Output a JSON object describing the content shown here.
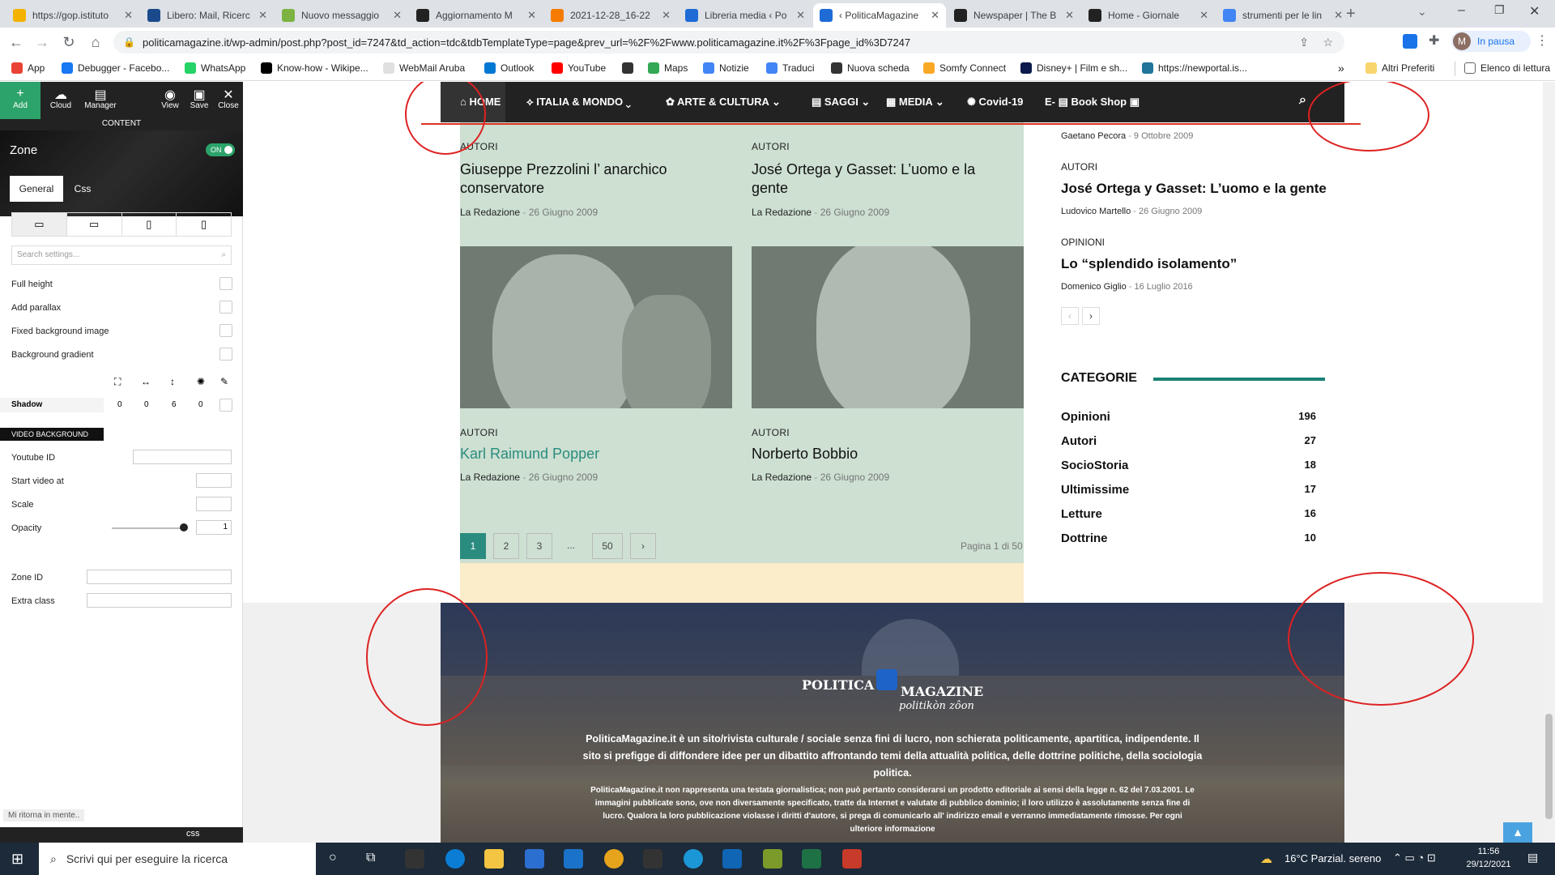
{
  "browser": {
    "tabs": [
      {
        "label": "https://gop.istituto",
        "color": "#f3b300"
      },
      {
        "label": "Libero: Mail, Ricerc",
        "color": "#1a4a8c"
      },
      {
        "label": "Nuovo messaggio",
        "color": "#7cb342"
      },
      {
        "label": "Aggiornamento M",
        "color": "#222222"
      },
      {
        "label": "2021-12-28_16-22",
        "color": "#f57c00"
      },
      {
        "label": "Libreria media ‹ Po",
        "color": "#1e6bd6"
      },
      {
        "label": "‹ PoliticaMagazine",
        "color": "#1e6bd6"
      },
      {
        "label": "Newspaper | The B",
        "color": "#222222"
      },
      {
        "label": "Home - Giornale",
        "color": "#222222"
      },
      {
        "label": "strumenti per le lin",
        "color": "#4285f4"
      }
    ],
    "url": "politicamagazine.it/wp-admin/post.php?post_id=7247&td_action=tdc&tdbTemplateType=page&prev_url=%2F%2Fwww.politicamagazine.it%2F%3Fpage_id%3D7247",
    "profile_label": "In pausa",
    "profile_initial": "M",
    "bookmarks": [
      {
        "label": "App",
        "color": "#ea4335"
      },
      {
        "label": "Debugger - Facebo...",
        "color": "#1877f2"
      },
      {
        "label": "WhatsApp",
        "color": "#25d366"
      },
      {
        "label": "Know-how - Wikipe...",
        "color": "#000000"
      },
      {
        "label": "WebMail Aruba",
        "color": "#e0e0e0"
      },
      {
        "label": "Outlook",
        "color": "#0078d4"
      },
      {
        "label": "YouTube",
        "color": "#ff0000"
      },
      {
        "label": "",
        "color": "#333333"
      },
      {
        "label": "Maps",
        "color": "#34a853"
      },
      {
        "label": "Notizie",
        "color": "#4285f4"
      },
      {
        "label": "Traduci",
        "color": "#4285f4"
      },
      {
        "label": "Nuova scheda",
        "color": "#333333"
      },
      {
        "label": "Somfy Connect",
        "color": "#f9a825"
      },
      {
        "label": "Disney+ | Film e sh...",
        "color": "#0b1a4a"
      },
      {
        "label": "https://newportal.is...",
        "color": "#21759b"
      }
    ],
    "bookmarks_more": "»",
    "bookmarks_other": "Altri Preferiti",
    "reading_list": "Elenco di lettura"
  },
  "editor": {
    "toolbar": {
      "add": "Add",
      "cloud": "Cloud",
      "manager": "Manager",
      "view": "View",
      "save": "Save",
      "close": "Close"
    },
    "content_label": "CONTENT",
    "zone_title": "Zone",
    "zone_toggle": "ON",
    "tabs": {
      "general": "General",
      "css": "Css"
    },
    "search_placeholder": "Search settings...",
    "options": [
      "Full height",
      "Add parallax",
      "Fixed background image",
      "Background gradient"
    ],
    "shadow_label": "Shadow",
    "shadow_values": [
      "0",
      "0",
      "6",
      "0"
    ],
    "video_bg": "VIDEO BACKGROUND",
    "video_fields": {
      "youtube": "Youtube ID",
      "start": "Start video at",
      "scale": "Scale",
      "opacity": "Opacity",
      "opacity_value": "1"
    },
    "zone_id": "Zone ID",
    "extra_class": "Extra class",
    "status_text": "Mi ritorna in mente..",
    "bottom_css": "css"
  },
  "site": {
    "nav": [
      "HOME",
      "ITALIA & MONDO",
      "ARTE & CULTURA",
      "SAGGI",
      "MEDIA",
      "Covid-19",
      "E-",
      "Book Shop"
    ],
    "cards": [
      {
        "tag": "AUTORI",
        "title": "Giuseppe Prezzolini l’ anarchico conservatore",
        "author": "La Redazione",
        "date": "26 Giugno 2009"
      },
      {
        "tag": "AUTORI",
        "title": "José Ortega y Gasset: L’uomo e la gente",
        "author": "La Redazione",
        "date": "26 Giugno 2009"
      },
      {
        "tag": "AUTORI",
        "title": "Karl Raimund Popper",
        "author": "La Redazione",
        "date": "26 Giugno 2009"
      },
      {
        "tag": "AUTORI",
        "title": "Norberto Bobbio",
        "author": "La Redazione",
        "date": "26 Giugno 2009"
      }
    ],
    "pagination": {
      "pages": [
        "1",
        "2",
        "3",
        "...",
        "50"
      ],
      "next": "›",
      "info": "Pagina 1 di 50"
    },
    "sidebar": {
      "top_meta": {
        "author": "Gaetano Pecora",
        "date": "9 Ottobre 2009"
      },
      "items": [
        {
          "tag": "AUTORI",
          "title": "José Ortega y Gasset: L’uomo e la gente",
          "author": "Ludovico Martello",
          "date": "26 Giugno 2009"
        },
        {
          "tag": "OPINIONI",
          "title": "Lo “splendido isolamento”",
          "author": "Domenico Giglio",
          "date": "16 Luglio 2016"
        }
      ],
      "categories_title": "CATEGORIE",
      "categories": [
        {
          "name": "Opinioni",
          "count": "196"
        },
        {
          "name": "Autori",
          "count": "27"
        },
        {
          "name": "SocioStoria",
          "count": "18"
        },
        {
          "name": "Ultimissime",
          "count": "17"
        },
        {
          "name": "Letture",
          "count": "16"
        },
        {
          "name": "Dottrine",
          "count": "10"
        }
      ]
    },
    "footer": {
      "logo_left": "POLITICA",
      "logo_right": "MAGAZINE",
      "logo_sub": "politikòn zôon",
      "about": "PoliticaMagazine.it è un sito/rivista culturale / sociale senza fini di lucro, non schierata politicamente, apartitica, indipendente. Il sito si prefigge di diffondere idee per un dibattito affrontando temi della attualità politica, delle dottrine politiche, della sociologia politica.",
      "legal": "PoliticaMagazine.it non rappresenta una testata giornalistica; non può pertanto considerarsi un prodotto editoriale ai sensi della legge n. 62 del 7.03.2001. Le immagini pubblicate sono, ove non diversamente specificato, tratte da Internet e valutate di pubblico dominio; il loro utilizzo è assolutamente senza fine di lucro. Qualora la loro pubblicazione violasse i diritti d'autore, si prega di comunicarlo all' indirizzo email e verranno immediatamente rimosse. Per ogni ulteriore informazione"
    }
  },
  "taskbar": {
    "search_placeholder": "Scrivi qui per eseguire la ricerca",
    "weather": "16°C  Parzial. sereno",
    "time": "11:56",
    "date": "29/12/2021"
  }
}
